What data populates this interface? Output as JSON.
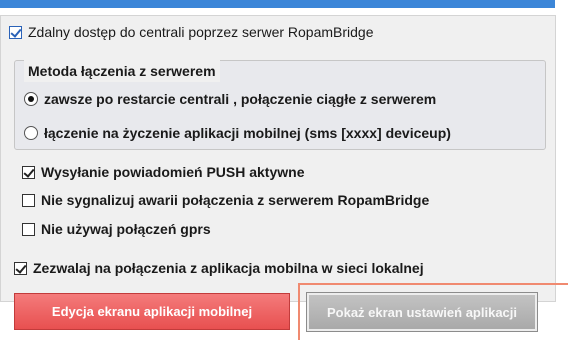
{
  "remote_access": {
    "label": "Zdalny dostęp do centrali poprzez serwer RopamBridge",
    "checked": true
  },
  "method_group": {
    "title": "Metoda łączenia z serwerem",
    "options": [
      {
        "label": "zawsze po restarcie centrali , połączenie ciągłe z serwerem",
        "selected": true
      },
      {
        "label": "łączenie na życzenie aplikacji mobilnej  (sms [xxxx] deviceup)",
        "selected": false
      }
    ]
  },
  "options": [
    {
      "label": "Wysyłanie powiadomień PUSH aktywne",
      "checked": true
    },
    {
      "label": "Nie sygnalizuj awarii  połączenia z serwerem RopamBridge",
      "checked": false
    },
    {
      "label": "Nie używaj połączeń gprs",
      "checked": false
    },
    {
      "label": "Zezwalaj na połączenia z aplikacja mobilna w sieci lokalnej",
      "checked": true
    }
  ],
  "buttons": {
    "edit_mobile_screen": "Edycja ekranu aplikacji mobilnej",
    "show_settings_screen": "Pokaż ekran ustawień aplikacji"
  },
  "colors": {
    "title_bar": "#3c86d8",
    "red_button": "#e85050",
    "gray_button": "#b4b4b4",
    "annotation": "#f08a70"
  }
}
